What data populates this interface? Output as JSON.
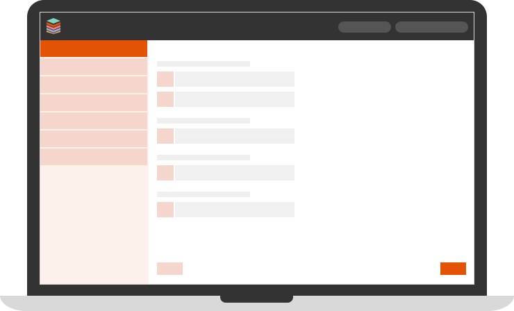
{
  "colors": {
    "bezel": "#333333",
    "topbar": "#333333",
    "pill": "#555555",
    "accent": "#e35205",
    "sidebar_bg": "#fdf1ec",
    "sidebar_item": "#f5d6cd",
    "placeholder_grey": "#efefef",
    "input_bg": "#f0f0f0",
    "prefix": "#f5d6cd",
    "base": "#d9d9d9",
    "notch": "#333333"
  },
  "icons": {
    "logo": "stacked-layers-icon"
  },
  "header": {
    "nav_pills": 2
  },
  "sidebar": {
    "items": [
      {
        "state": "active"
      },
      {
        "state": "normal"
      },
      {
        "state": "normal"
      },
      {
        "state": "normal"
      },
      {
        "state": "normal"
      },
      {
        "state": "normal"
      },
      {
        "state": "normal"
      }
    ]
  },
  "form": {
    "sections": [
      {
        "fields": 2
      },
      {
        "fields": 1
      },
      {
        "fields": 1
      },
      {
        "fields": 1
      }
    ],
    "back_label": "",
    "next_label": ""
  }
}
